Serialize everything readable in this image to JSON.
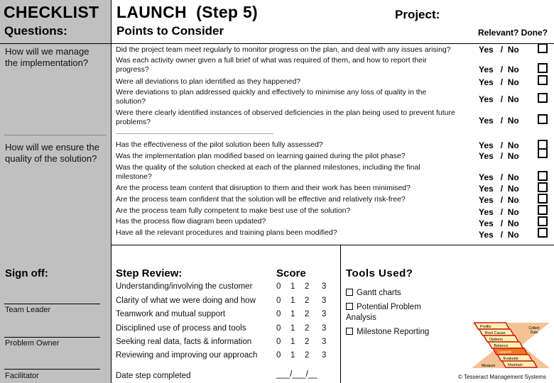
{
  "header": {
    "checklist": "CHECKLIST",
    "questions": "Questions:",
    "title": "LAUNCH  (Step 5)",
    "points": "Points to Consider",
    "project": "Project:",
    "relevant_done": "Relevant? Done?"
  },
  "yes_no": "Yes   /  No",
  "sections": [
    {
      "question": "How will we manage the implementation?",
      "items": [
        "Did the project team meet regularly to monitor progress on the plan, and deal with any issues arising?",
        "Was each activity owner given a full brief of what was required of them, and how to report their progress?",
        "Were all deviations to plan identified as they happened?",
        "Were deviations to plan addressed quickly and effectively to minimise any loss of quality in the solution?",
        "Were there clearly identified instances of observed deficiencies in the plan being used to prevent future problems?"
      ]
    },
    {
      "question": "How will we ensure the quality of the solution?",
      "items": [
        "Has the effectiveness of the pilot solution been fully assessed?",
        "Was the implementation plan modified based on learning gained during the pilot phase?",
        "Was the quality of the solution checked at each of the planned milestones, including the final milestone?",
        "Are the process team content that disruption to them and their work has been minimised?",
        "Are the process team confident that the solution will be effective and relatively risk-free?",
        "Are the process team fully competent to make best use of the solution?",
        "Has the process flow diagram been updated?",
        "Have all the relevant procedures and training plans been modified?"
      ]
    }
  ],
  "signoff": {
    "title": "Sign off:",
    "roles": [
      "Team Leader",
      "Problem Owner",
      "Facilitator"
    ]
  },
  "step_review": {
    "title": "Step Review:",
    "score_title": "Score",
    "scale": [
      "0",
      "1",
      "2",
      "3"
    ],
    "items": [
      "Understanding/involving the customer",
      "Clarity of what we were doing and how",
      "Teamwork and mutual support",
      "Disciplined use of process and tools",
      "Seeking real data, facts & information",
      "Reviewing and improving our approach"
    ],
    "date_label": "Date step completed",
    "date_blank": "___/___/__"
  },
  "tools": {
    "title": "Tools Used?",
    "items": [
      "Gantt charts",
      "Potential Problem Analysis",
      "Milestone Reporting"
    ]
  },
  "logo": {
    "steps": [
      "Profile",
      "Root Cause",
      "Options",
      "Balance",
      "Launch",
      "Evaluate",
      "Maintain"
    ],
    "highlight": "Launch",
    "collect": "Collect Data",
    "measure": "Measure",
    "colors": {
      "band": "#f0a868",
      "step_fill": "#fff2b0",
      "step_border": "#d21a1a",
      "highlight": "#f07a20",
      "initial": "#d21a1a"
    }
  },
  "copyright": "© Tesseract Management Systems"
}
